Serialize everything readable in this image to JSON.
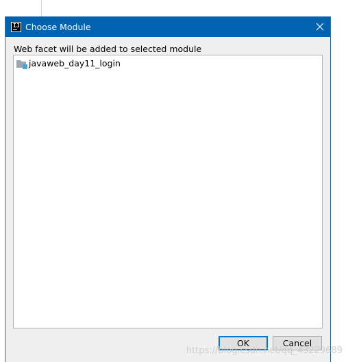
{
  "window": {
    "title": "Choose Module",
    "app_icon_label": "IJ"
  },
  "dialog": {
    "prompt": "Web facet will be added to selected module",
    "modules": [
      {
        "label": "javaweb_day11_login",
        "icon": "module-folder-icon"
      }
    ]
  },
  "buttons": {
    "ok_label": "OK",
    "cancel_label": "Cancel"
  },
  "watermark": "https://blog.csdn.net/qq_43229689",
  "colors": {
    "titlebar": "#0063b1",
    "dialog_bg": "#f0f0f0",
    "ok_border": "#0078d7"
  }
}
